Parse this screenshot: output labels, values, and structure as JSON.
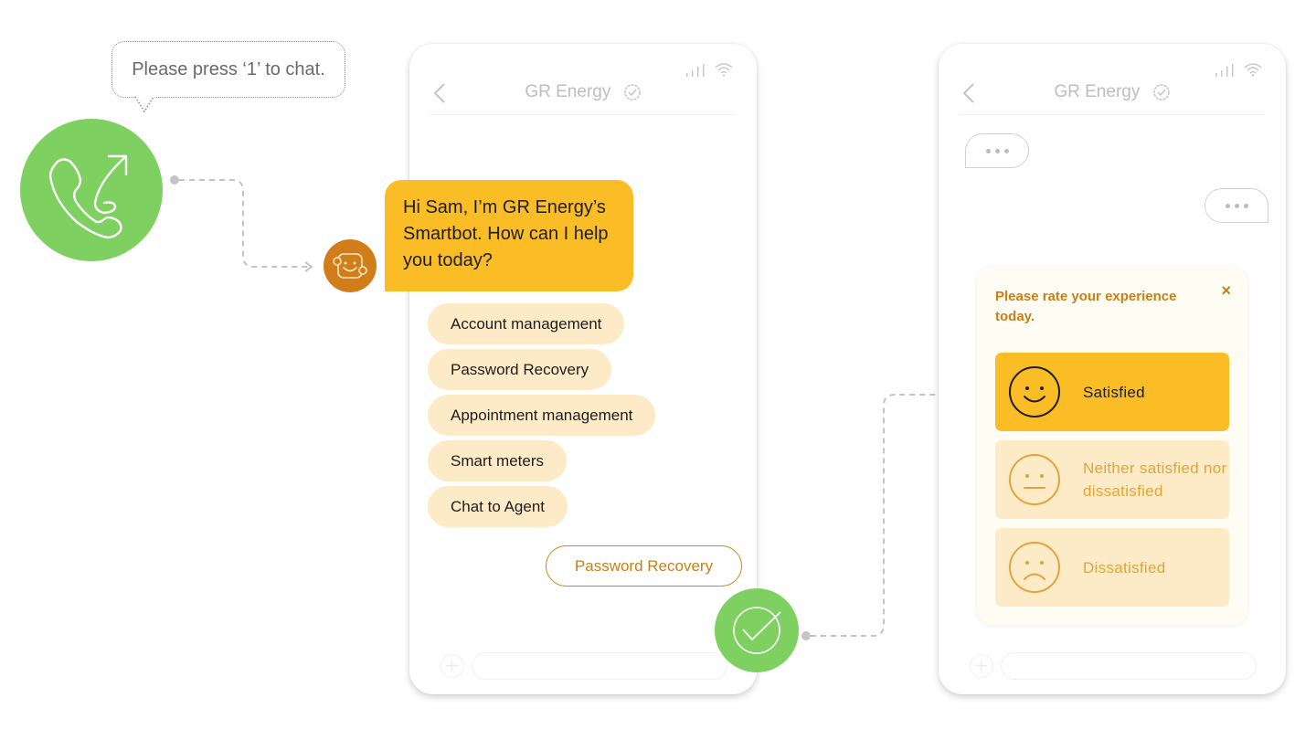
{
  "call_step": {
    "prompt": "Please press ‘1’ to chat.",
    "icon": "phone-outgoing-icon",
    "accent": "#7ed060"
  },
  "chat_screen": {
    "title": "GR Energy",
    "verified_icon": "verified-badge-icon",
    "bot_avatar_icon": "smartbot-icon",
    "bot_message": "Hi Sam, I’m GR Energy’s Smartbot. How can I help you today?",
    "quick_replies": [
      {
        "label": "Account management"
      },
      {
        "label": "Password Recovery"
      },
      {
        "label": "Appointment management"
      },
      {
        "label": "Smart meters"
      },
      {
        "label": "Chat to Agent"
      }
    ],
    "user_reply": "Password Recovery",
    "completed_icon": "checkmark-icon",
    "composer_placeholder": ""
  },
  "survey_screen": {
    "title": "GR Energy",
    "verified_icon": "verified-badge-icon",
    "rating_title": "Please rate your experience  today.",
    "close_label": "×",
    "options": [
      {
        "label": "Satisfied",
        "icon": "smile-face-icon",
        "selected": true
      },
      {
        "label": "Neither satisfied nor dissatisfied",
        "icon": "neutral-face-icon",
        "selected": false
      },
      {
        "label": "Dissatisfied",
        "icon": "sad-face-icon",
        "selected": false
      }
    ],
    "composer_placeholder": ""
  },
  "colors": {
    "brand_yellow": "#fbbd25",
    "chip_bg": "#fdebc8",
    "brand_orange": "#c77f16",
    "bot_avatar": "#d07d1a",
    "success_green": "#7ed060"
  }
}
